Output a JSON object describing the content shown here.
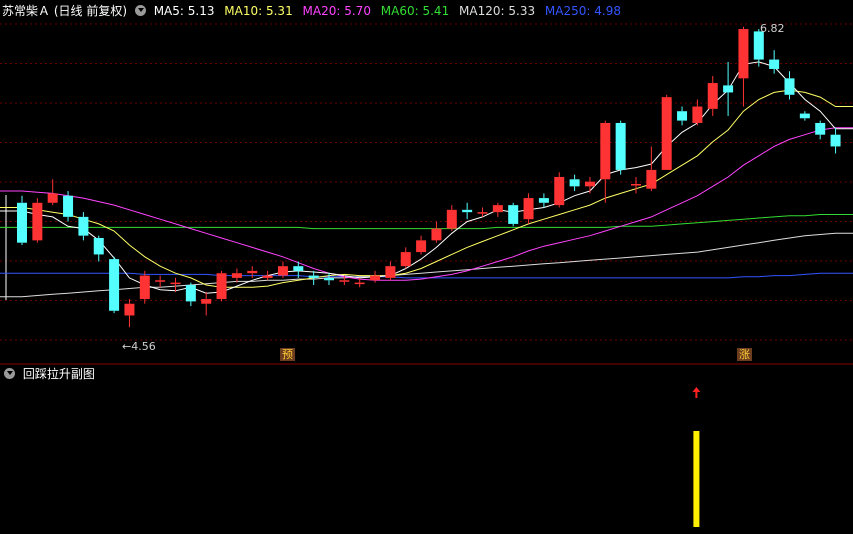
{
  "header": {
    "stock_name": "苏常柴Ａ",
    "period": "(日线 前复权)",
    "ma": [
      {
        "label": "MA5: 5.13",
        "color": "#ffffff"
      },
      {
        "label": "MA10: 5.31",
        "color": "#ffff66"
      },
      {
        "label": "MA20: 5.70",
        "color": "#ff44ff"
      },
      {
        "label": "MA60: 5.41",
        "color": "#33dd33"
      },
      {
        "label": "MA120: 5.33",
        "color": "#dddddd"
      },
      {
        "label": "MA250: 4.98",
        "color": "#3355ff"
      }
    ]
  },
  "annotations": {
    "low": "4.56",
    "high": "6.82",
    "marker_yu": "预",
    "marker_zhang": "涨"
  },
  "indicator": {
    "title": "回踩拉升副图",
    "bar_color": "#ffee00",
    "arrow_color": "#ff2222"
  },
  "colors": {
    "up": "#ff3333",
    "down": "#54ffff",
    "grid": "#6b0000"
  },
  "chart_data": {
    "type": "candlestick",
    "title": "",
    "candles": [
      [
        5.62,
        5.28,
        5.68,
        5.26
      ],
      [
        5.3,
        5.62,
        5.66,
        5.28
      ],
      [
        5.62,
        5.7,
        5.82,
        5.6
      ],
      [
        5.68,
        5.5,
        5.72,
        5.46
      ],
      [
        5.5,
        5.34,
        5.54,
        5.3
      ],
      [
        5.32,
        5.18,
        5.34,
        5.12
      ],
      [
        5.14,
        4.7,
        5.16,
        4.68
      ],
      [
        4.66,
        4.76,
        4.8,
        4.56
      ],
      [
        4.8,
        5.0,
        5.04,
        4.76
      ],
      [
        4.96,
        4.96,
        5.0,
        4.9
      ],
      [
        4.94,
        4.94,
        4.98,
        4.86
      ],
      [
        4.92,
        4.78,
        4.94,
        4.74
      ],
      [
        4.76,
        4.8,
        4.86,
        4.66
      ],
      [
        4.8,
        5.02,
        5.04,
        4.78
      ],
      [
        4.98,
        5.02,
        5.06,
        4.94
      ],
      [
        5.02,
        5.04,
        5.08,
        4.98
      ],
      [
        4.98,
        5.0,
        5.04,
        4.96
      ],
      [
        5.0,
        5.08,
        5.12,
        4.98
      ],
      [
        5.08,
        5.04,
        5.12,
        4.98
      ],
      [
        5.0,
        4.98,
        5.04,
        4.92
      ],
      [
        4.98,
        4.96,
        5.02,
        4.92
      ],
      [
        4.96,
        4.96,
        5.0,
        4.92
      ],
      [
        4.94,
        4.94,
        4.98,
        4.9
      ],
      [
        4.96,
        5.0,
        5.04,
        4.94
      ],
      [
        4.98,
        5.08,
        5.12,
        4.96
      ],
      [
        5.08,
        5.2,
        5.24,
        5.06
      ],
      [
        5.2,
        5.3,
        5.34,
        5.18
      ],
      [
        5.3,
        5.4,
        5.46,
        5.28
      ],
      [
        5.4,
        5.56,
        5.6,
        5.38
      ],
      [
        5.56,
        5.54,
        5.62,
        5.48
      ],
      [
        5.54,
        5.54,
        5.58,
        5.5
      ],
      [
        5.54,
        5.6,
        5.62,
        5.5
      ],
      [
        5.6,
        5.44,
        5.62,
        5.42
      ],
      [
        5.48,
        5.66,
        5.7,
        5.44
      ],
      [
        5.66,
        5.62,
        5.7,
        5.58
      ],
      [
        5.6,
        5.84,
        5.88,
        5.58
      ],
      [
        5.82,
        5.76,
        5.86,
        5.72
      ],
      [
        5.76,
        5.8,
        5.84,
        5.7
      ],
      [
        5.82,
        6.3,
        6.32,
        5.62
      ],
      [
        6.3,
        5.9,
        6.32,
        5.86
      ],
      [
        5.78,
        5.78,
        5.84,
        5.7
      ],
      [
        5.74,
        5.9,
        6.1,
        5.72
      ],
      [
        5.9,
        6.52,
        6.54,
        5.9
      ],
      [
        6.4,
        6.32,
        6.44,
        6.28
      ],
      [
        6.3,
        6.44,
        6.5,
        6.28
      ],
      [
        6.42,
        6.64,
        6.7,
        6.36
      ],
      [
        6.62,
        6.56,
        6.82,
        6.36
      ],
      [
        6.68,
        7.1,
        7.12,
        6.44
      ],
      [
        7.08,
        6.84,
        7.1,
        6.78
      ],
      [
        6.84,
        6.76,
        6.92,
        6.72
      ],
      [
        6.68,
        6.54,
        6.74,
        6.5
      ],
      [
        6.38,
        6.34,
        6.4,
        6.32
      ],
      [
        6.3,
        6.2,
        6.32,
        6.16
      ],
      [
        6.2,
        6.1,
        6.26,
        6.04
      ]
    ],
    "ma5": [
      5.55,
      5.52,
      5.5,
      5.42,
      5.4,
      5.3,
      5.15,
      4.98,
      4.92,
      4.88,
      4.87,
      4.9,
      4.85,
      4.86,
      4.91,
      4.96,
      5.0,
      5.03,
      5.04,
      5.03,
      5.02,
      5.0,
      4.98,
      4.99,
      5.0,
      5.06,
      5.14,
      5.24,
      5.36,
      5.46,
      5.5,
      5.56,
      5.54,
      5.56,
      5.58,
      5.62,
      5.68,
      5.72,
      5.86,
      5.9,
      5.92,
      5.95,
      6.1,
      6.22,
      6.3,
      6.46,
      6.58,
      6.8,
      6.82,
      6.78,
      6.64,
      6.5,
      6.4,
      6.25
    ],
    "ma10": [
      5.58,
      5.56,
      5.54,
      5.52,
      5.48,
      5.44,
      5.38,
      5.26,
      5.16,
      5.08,
      5.02,
      4.98,
      4.92,
      4.9,
      4.9,
      4.9,
      4.91,
      4.94,
      4.96,
      4.98,
      5.0,
      5.01,
      5.0,
      5.0,
      5.0,
      5.02,
      5.06,
      5.12,
      5.18,
      5.24,
      5.29,
      5.34,
      5.39,
      5.44,
      5.48,
      5.52,
      5.56,
      5.6,
      5.66,
      5.7,
      5.74,
      5.78,
      5.86,
      5.94,
      6.02,
      6.14,
      6.24,
      6.4,
      6.5,
      6.56,
      6.58,
      6.56,
      6.52,
      6.44
    ],
    "ma20": [
      5.72,
      5.71,
      5.7,
      5.68,
      5.66,
      5.63,
      5.6,
      5.56,
      5.52,
      5.48,
      5.44,
      5.4,
      5.36,
      5.32,
      5.28,
      5.24,
      5.2,
      5.16,
      5.11,
      5.06,
      5.02,
      4.99,
      4.97,
      4.96,
      4.96,
      4.96,
      4.97,
      4.99,
      5.01,
      5.04,
      5.08,
      5.12,
      5.16,
      5.21,
      5.25,
      5.28,
      5.31,
      5.34,
      5.38,
      5.42,
      5.46,
      5.5,
      5.56,
      5.62,
      5.68,
      5.76,
      5.84,
      5.94,
      6.02,
      6.1,
      6.16,
      6.2,
      6.24,
      6.26
    ],
    "ma60": [
      5.41,
      5.41,
      5.41,
      5.41,
      5.41,
      5.41,
      5.41,
      5.41,
      5.41,
      5.41,
      5.41,
      5.41,
      5.41,
      5.41,
      5.41,
      5.41,
      5.41,
      5.41,
      5.41,
      5.4,
      5.4,
      5.4,
      5.4,
      5.4,
      5.4,
      5.4,
      5.4,
      5.4,
      5.4,
      5.4,
      5.4,
      5.41,
      5.41,
      5.41,
      5.41,
      5.41,
      5.41,
      5.41,
      5.41,
      5.42,
      5.42,
      5.42,
      5.43,
      5.44,
      5.45,
      5.46,
      5.47,
      5.48,
      5.49,
      5.5,
      5.51,
      5.51,
      5.52,
      5.52
    ],
    "ma120": [
      4.82,
      4.83,
      4.84,
      4.85,
      4.86,
      4.87,
      4.88,
      4.89,
      4.9,
      4.9,
      4.91,
      4.92,
      4.93,
      4.94,
      4.95,
      4.95,
      4.96,
      4.96,
      4.97,
      4.97,
      4.98,
      4.98,
      4.99,
      4.99,
      5.0,
      5.01,
      5.02,
      5.03,
      5.04,
      5.05,
      5.06,
      5.07,
      5.08,
      5.09,
      5.1,
      5.11,
      5.12,
      5.13,
      5.14,
      5.15,
      5.16,
      5.17,
      5.18,
      5.19,
      5.2,
      5.22,
      5.24,
      5.26,
      5.28,
      5.3,
      5.32,
      5.34,
      5.35,
      5.36
    ],
    "ma250": [
      5.02,
      5.02,
      5.02,
      5.02,
      5.02,
      5.02,
      5.02,
      5.02,
      5.01,
      5.01,
      5.01,
      5.01,
      5.01,
      5.0,
      5.0,
      5.0,
      5.0,
      5.0,
      5.0,
      4.99,
      4.99,
      4.99,
      4.99,
      4.99,
      4.99,
      4.98,
      4.98,
      4.98,
      4.98,
      4.98,
      4.98,
      4.98,
      4.98,
      4.98,
      4.98,
      4.98,
      4.98,
      4.98,
      4.98,
      4.98,
      4.98,
      4.98,
      4.98,
      4.98,
      4.98,
      4.98,
      4.98,
      4.99,
      4.99,
      5.0,
      5.0,
      5.01,
      5.02,
      5.02
    ],
    "signal_index": 44,
    "marker_yu_index": 18,
    "marker_zhang_index": 49
  }
}
